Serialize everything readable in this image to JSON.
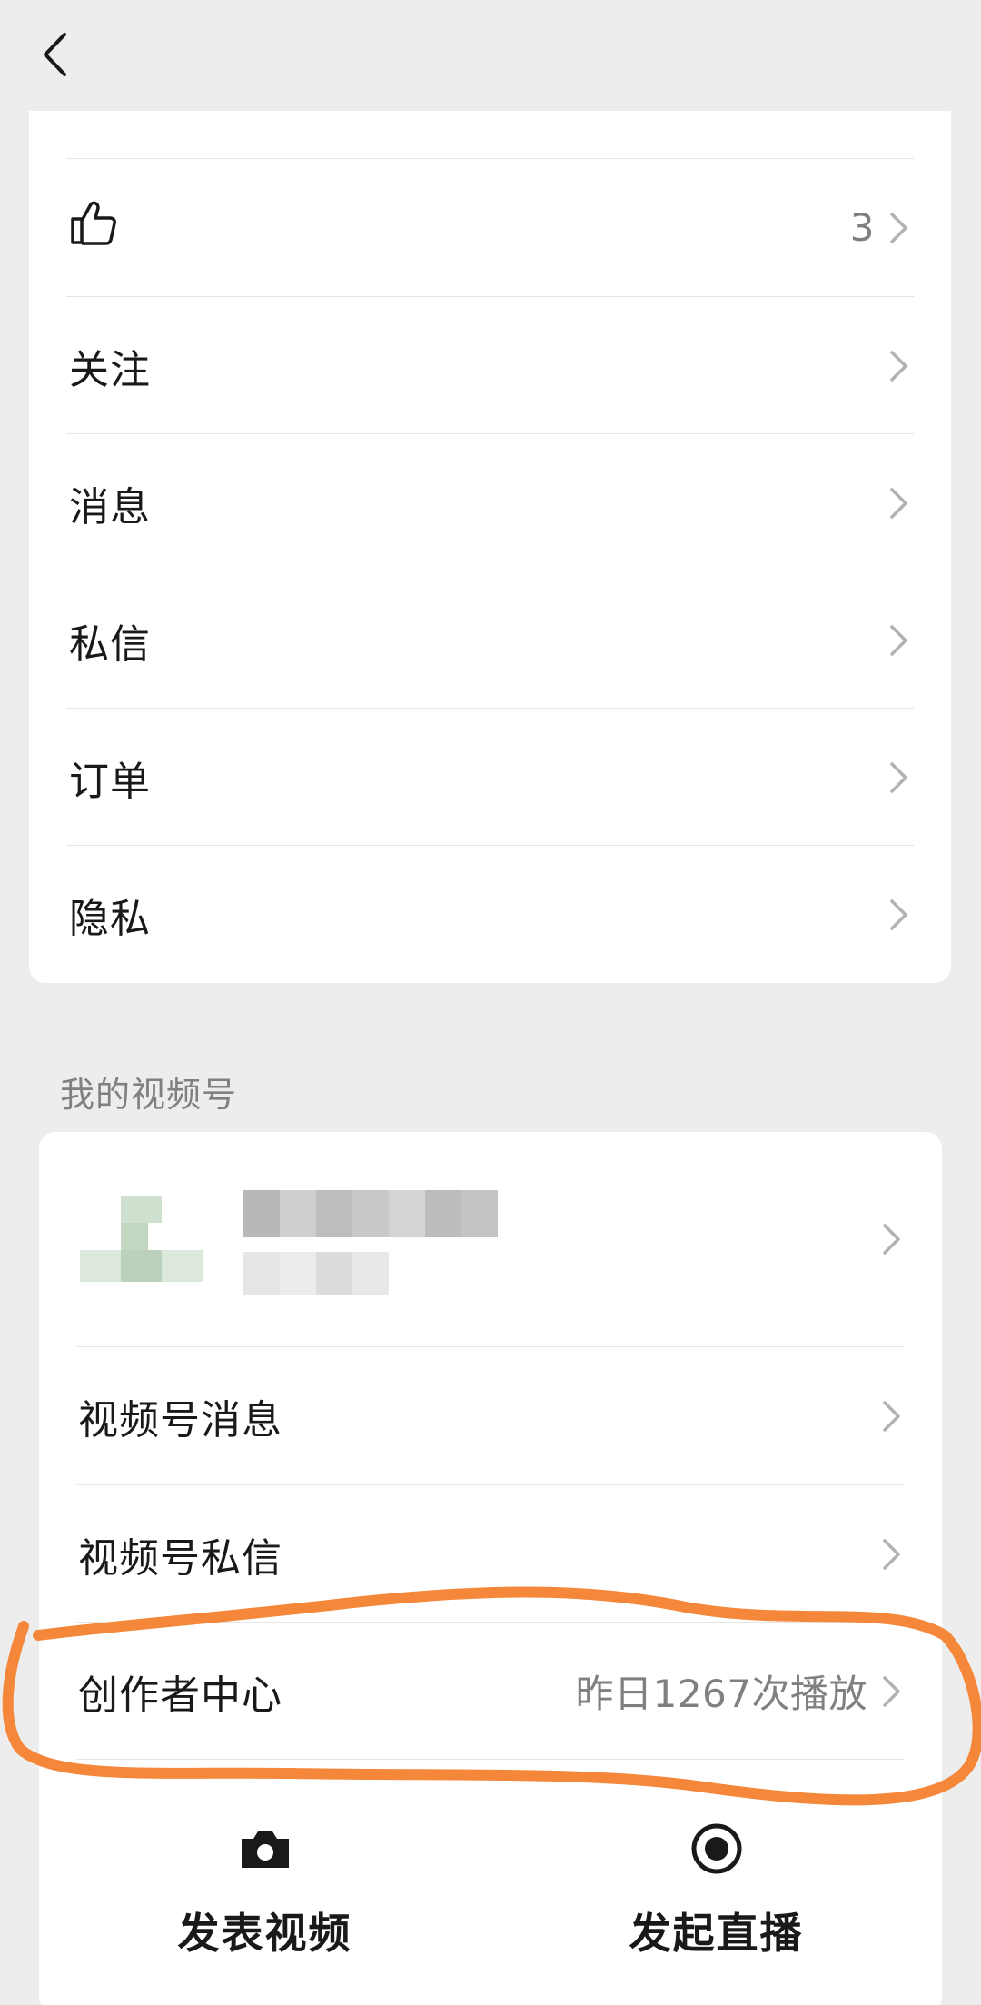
{
  "colors": {
    "page_bg": "#ededed",
    "card_bg": "#ffffff",
    "text": "#191919",
    "secondary": "#808080",
    "annotation": "#f5873a"
  },
  "top_menu": {
    "items": [
      {
        "icon": "thumbs-up-icon",
        "value": "3"
      },
      {
        "label": "关注"
      },
      {
        "label": "消息"
      },
      {
        "label": "私信"
      },
      {
        "label": "订单"
      },
      {
        "label": "隐私"
      }
    ]
  },
  "channels": {
    "section_title": "我的视频号",
    "items": [
      {
        "label": "视频号消息"
      },
      {
        "label": "视频号私信"
      },
      {
        "label": "创作者中心",
        "value": "昨日1267次播放"
      }
    ],
    "actions": [
      {
        "label": "发表视频",
        "icon": "camera-icon"
      },
      {
        "label": "发起直播",
        "icon": "live-record-icon"
      }
    ]
  }
}
